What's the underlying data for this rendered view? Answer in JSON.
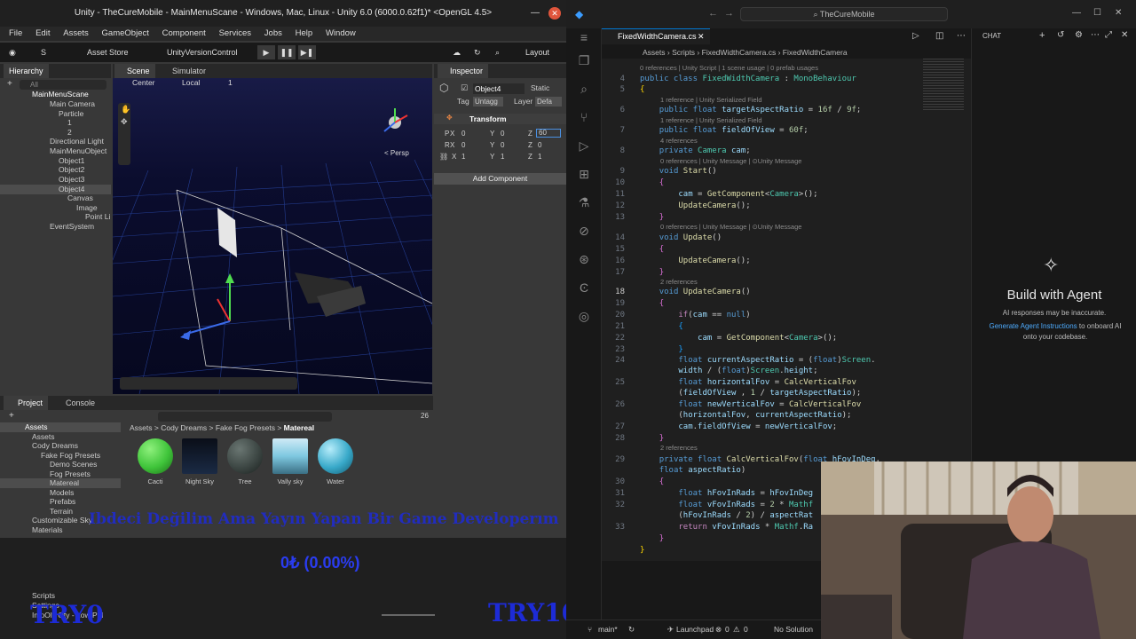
{
  "unity": {
    "title": "Unity - TheCureMobile - MainMenuScane - Windows, Mac, Linux - Unity 6.0 (6000.0.62f1)* <OpenGL 4.5>",
    "menu": [
      "File",
      "Edit",
      "Assets",
      "GameObject",
      "Component",
      "Services",
      "Jobs",
      "Help",
      "Window"
    ],
    "toolbar": {
      "account": "S",
      "asset_store": "Asset Store",
      "version_control": "UnityVersionControl",
      "layout": "Layout"
    },
    "hierarchy": {
      "tab": "Hierarchy",
      "search_placeholder": "All",
      "items": [
        {
          "label": "MainMenuScane"
        },
        {
          "label": "Main Camera"
        },
        {
          "label": "Particle"
        },
        {
          "label": "1"
        },
        {
          "label": "2"
        },
        {
          "label": "Directional Light"
        },
        {
          "label": "MainMenuObject"
        },
        {
          "label": "Object1"
        },
        {
          "label": "Object2"
        },
        {
          "label": "Object3"
        },
        {
          "label": "Object4"
        },
        {
          "label": "Canvas"
        },
        {
          "label": "Image"
        },
        {
          "label": "Point Li"
        },
        {
          "label": "EventSystem"
        }
      ]
    },
    "scene": {
      "tab": "Scene",
      "simulator_tab": "Simulator",
      "pivot": "Center",
      "space": "Local",
      "grid_value": "1",
      "persp": "< Persp"
    },
    "inspector": {
      "tab": "Inspector",
      "object_name": "Object4",
      "static_label": "Static",
      "tag_label": "Tag",
      "tag_value": "Untagg",
      "layer_label": "Layer",
      "layer_value": "Defa",
      "component": "Transform",
      "position": {
        "label": "P",
        "x": "0",
        "y": "0",
        "z": "60"
      },
      "rotation": {
        "label": "R",
        "x": "0",
        "y": "0",
        "z": "0"
      },
      "scale": {
        "x": "1",
        "y": "1",
        "z": "1"
      },
      "add_component": "Add Component"
    },
    "project": {
      "tab": "Project",
      "console_tab": "Console",
      "count": "26",
      "breadcrumb": [
        "Assets",
        "Cody Dreams",
        "Fake Fog Presets",
        "Matereal"
      ],
      "tree": [
        "Assets",
        "Assets",
        "Cody Dreams",
        "Fake Fog Presets",
        "Demo Scenes",
        "Fog Presets",
        "Matereal",
        "Models",
        "Prefabs",
        "Terrain",
        "Customizable Sky",
        "Materials",
        "Scripts",
        "Settings",
        "ImpOly Oty - Low Pol"
      ],
      "assets": [
        {
          "label": "Cacti",
          "color": "#3fc43a"
        },
        {
          "label": "Night Sky",
          "color": "#0e1624"
        },
        {
          "label": "Tree",
          "color": "#3d4744"
        },
        {
          "label": "Vally sky",
          "color": "#7ec8e0"
        },
        {
          "label": "Water",
          "color": "#38a9c9"
        }
      ]
    }
  },
  "overlays": {
    "banner": "Ibdeci Değilim Ama Yayın Yapan Bir Game Developerım",
    "goal": "0₺ (0.00%)",
    "left_amount": "TRY0",
    "right_amount": "TRY10000"
  },
  "vscode": {
    "search": "TheCureMobile",
    "tab": "FixedWidthCamera.cs",
    "breadcrumb": [
      "Assets",
      "Scripts",
      "FixedWidthCamera.cs",
      "FixedWidthCamera"
    ],
    "chat": {
      "title": "CHAT",
      "heading": "Build with Agent",
      "note": "AI responses may be inaccurate.",
      "link": "Generate Agent Instructions",
      "link_suffix": " to onboard AI onto your codebase."
    },
    "status": {
      "branch": "main*",
      "launchpad": "Launchpad",
      "errors": "0",
      "warnings": "0",
      "solution": "No Solution"
    }
  }
}
